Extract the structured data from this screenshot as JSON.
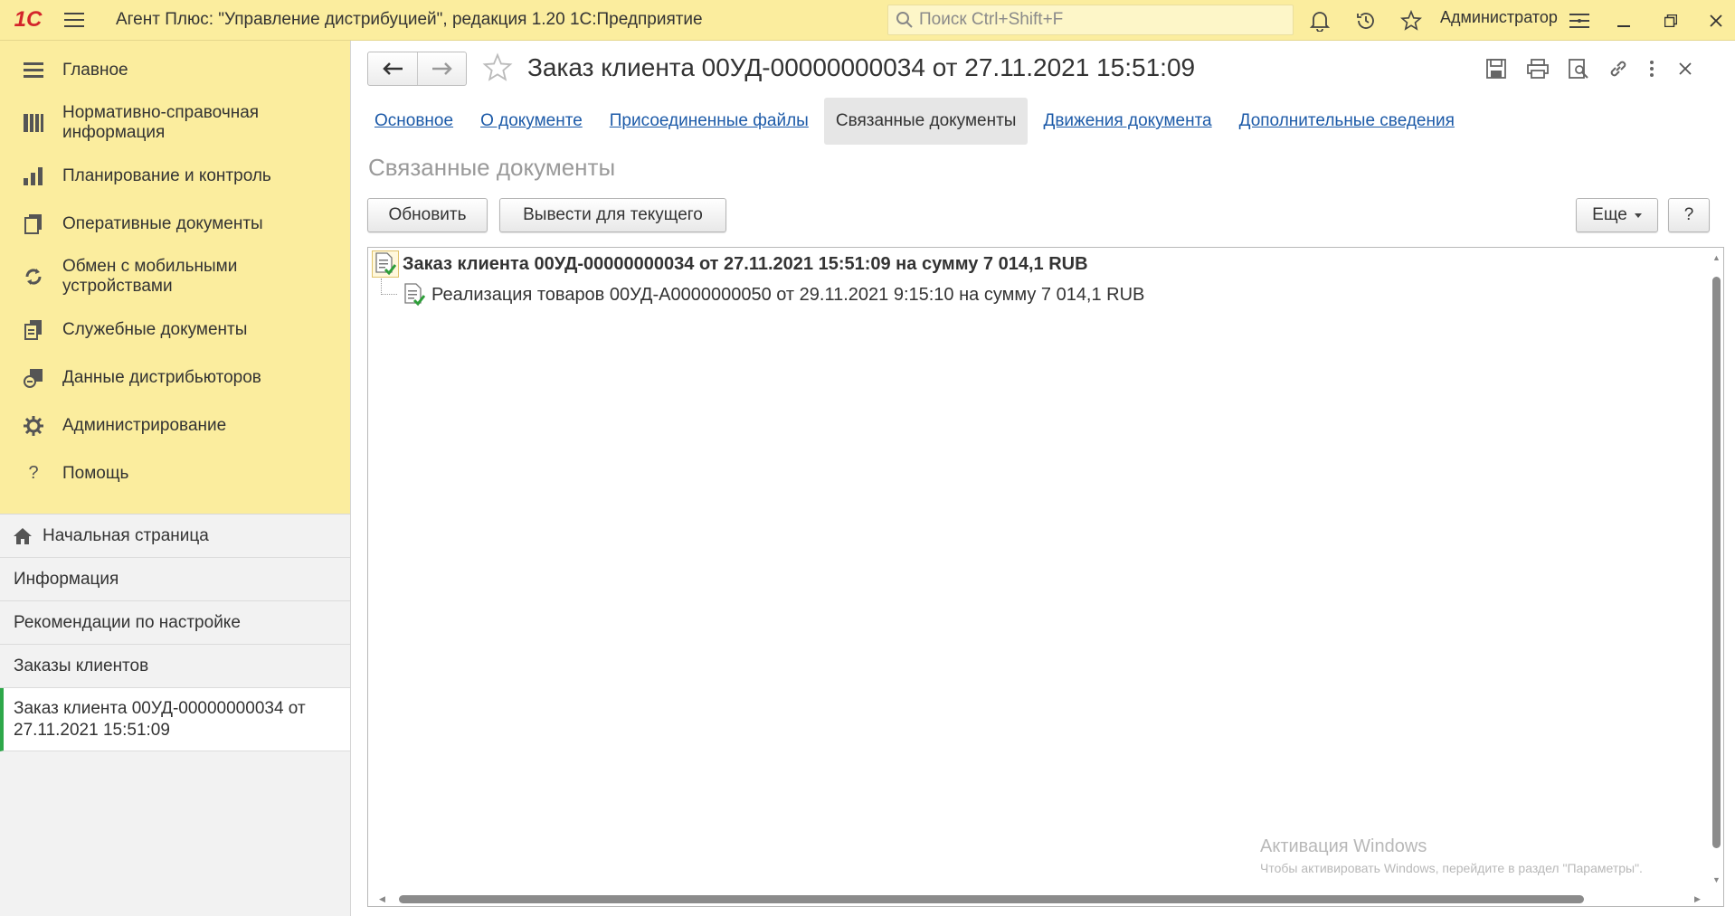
{
  "app": {
    "logo_text": "1С",
    "title": "Агент Плюс: \"Управление дистрибуцией\", редакция 1.20 1С:Предприятие",
    "search_placeholder": "Поиск Ctrl+Shift+F",
    "user": "Администратор",
    "accent_color": "#fbed9e",
    "logo_color": "#d4252b"
  },
  "sidebar": {
    "sections": [
      {
        "label": "Главное",
        "icon": "menu-lines-icon"
      },
      {
        "label": "Нормативно-справочная информация",
        "icon": "book-columns-icon"
      },
      {
        "label": "Планирование и контроль",
        "icon": "bar-chart-icon"
      },
      {
        "label": "Оперативные документы",
        "icon": "documents-icon"
      },
      {
        "label": "Обмен с мобильными устройствами",
        "icon": "sync-icon"
      },
      {
        "label": "Служебные документы",
        "icon": "service-docs-icon"
      },
      {
        "label": "Данные дистрибьюторов",
        "icon": "distributor-data-icon"
      },
      {
        "label": "Администрирование",
        "icon": "gear-icon"
      },
      {
        "label": "Помощь",
        "icon": "question-icon"
      }
    ],
    "open_windows": [
      {
        "label": "Начальная страница",
        "icon": "home-icon"
      },
      {
        "label": "Информация"
      },
      {
        "label": "Рекомендации по настройке"
      },
      {
        "label": "Заказы клиентов"
      },
      {
        "label": "Заказ клиента 00УД-00000000034 от 27.11.2021 15:51:09",
        "active": true
      }
    ]
  },
  "document": {
    "title": "Заказ клиента 00УД-00000000034 от 27.11.2021 15:51:09",
    "tabs": [
      {
        "label": "Основное",
        "active": false
      },
      {
        "label": "О документе",
        "active": false
      },
      {
        "label": "Присоединенные файлы",
        "active": false
      },
      {
        "label": "Связанные документы",
        "active": true
      },
      {
        "label": "Движения документа",
        "active": false
      },
      {
        "label": "Дополнительные сведения",
        "active": false
      }
    ],
    "section_title": "Связанные документы",
    "buttons": {
      "refresh": "Обновить",
      "show_current": "Вывести для текущего",
      "more": "Еще",
      "help": "?"
    },
    "tree": {
      "root": "Заказ клиента 00УД-00000000034 от 27.11.2021 15:51:09 на сумму 7 014,1 RUB",
      "children": [
        "Реализация товаров 00УД-А0000000050 от 29.11.2021 9:15:10 на сумму 7 014,1 RUB"
      ]
    }
  },
  "watermark": {
    "line1": "Активация Windows",
    "line2": "Чтобы активировать Windows, перейдите в раздел \"Параметры\"."
  }
}
